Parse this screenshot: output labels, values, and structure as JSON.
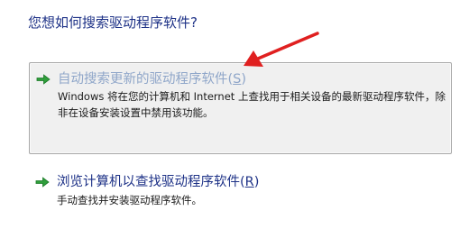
{
  "question": "您想如何搜索驱动程序软件?",
  "options": [
    {
      "title_prefix": "自动搜索更新的驱动程序软件(",
      "accesskey": "S",
      "title_suffix": ")",
      "description": "Windows 将在您的计算机和 Internet 上查找用于相关设备的最新驱动程序软件，除非在设备安装设置中禁用该功能。"
    },
    {
      "title_prefix": "浏览计算机以查找驱动程序软件(",
      "accesskey": "R",
      "title_suffix": ")",
      "description": "手动查找并安装驱动程序软件。"
    }
  ],
  "colors": {
    "heading_blue": "#1e3287",
    "disabled_title": "#8fa6c9",
    "arrow_green": "#2f9e3b",
    "annotation_red": "#e02020"
  },
  "icons": {
    "option_arrow": "green-right-arrow-icon",
    "annotation": "red-pointer-arrow"
  }
}
